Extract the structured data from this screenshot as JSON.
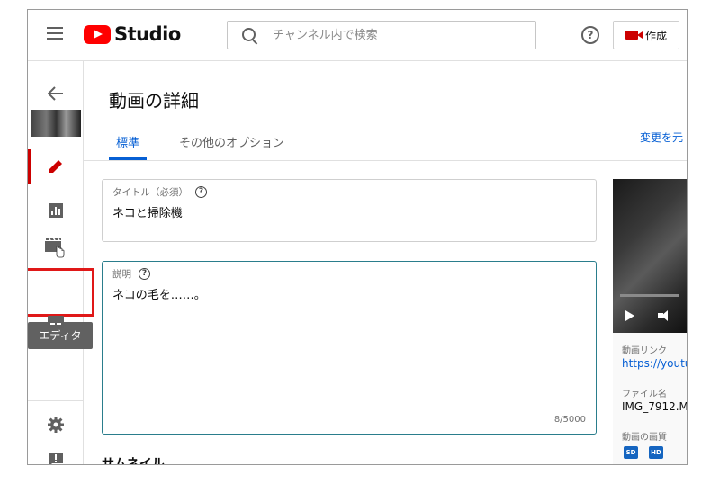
{
  "header": {
    "logo_text": "Studio",
    "search_placeholder": "チャンネル内で検索",
    "help_icon": "question-icon",
    "create_label": "作成"
  },
  "sidebar": {
    "items": [
      "back-arrow-icon",
      "video-thumbnail",
      "pencil-icon",
      "analytics-icon",
      "editor-clapper-icon",
      "subtitles-icon",
      "settings-icon",
      "feedback-icon"
    ],
    "tooltip": "エディタ"
  },
  "main": {
    "title": "動画の詳細",
    "tabs": [
      {
        "label": "標準",
        "active": true
      },
      {
        "label": "その他のオプション",
        "active": false
      }
    ],
    "undo_label": "変更を元",
    "title_field": {
      "label": "タイトル（必須）",
      "value": "ネコと掃除機"
    },
    "description_field": {
      "label": "説明",
      "value": "ネコの毛を……。",
      "counter": "8/5000"
    },
    "thumbnail_heading": "サムネイル"
  },
  "right_panel": {
    "link_label": "動画リンク",
    "link_value": "https://youtu",
    "filename_label": "ファイル名",
    "filename_value": "IMG_7912.M",
    "quality_label": "動画の画質",
    "quality_badges": [
      "SD",
      "HD"
    ]
  },
  "colors": {
    "accent_blue": "#065fd4",
    "brand_red": "#ff0000",
    "highlight_red": "#e01818"
  }
}
